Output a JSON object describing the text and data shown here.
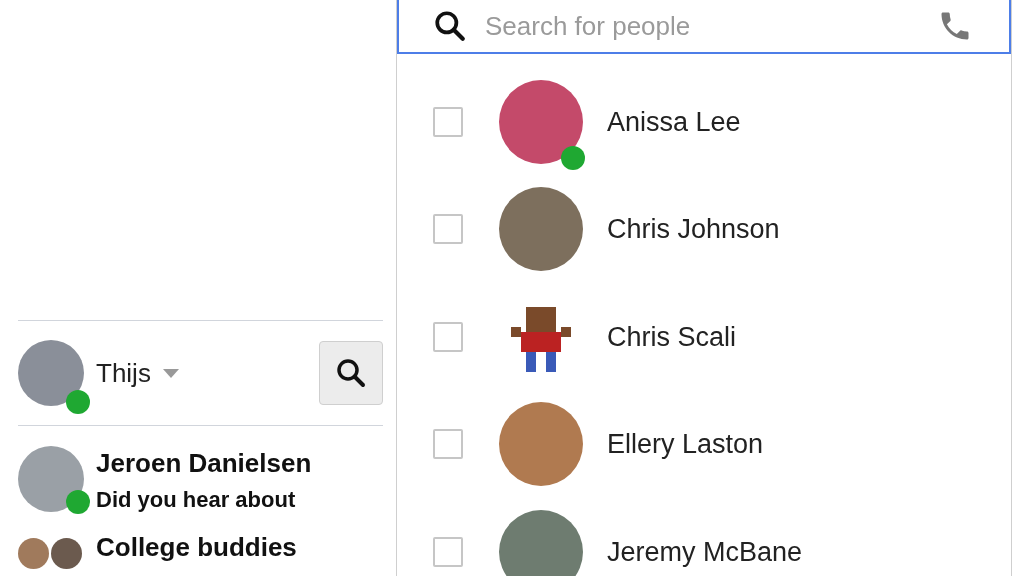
{
  "sidebar": {
    "user": {
      "name": "Thijs",
      "online": true
    },
    "conversations": [
      {
        "kind": "person",
        "name": "Jeroen Danielsen",
        "snippet": "Did you hear about",
        "online": true
      },
      {
        "kind": "group",
        "name": "College buddies"
      }
    ]
  },
  "people_search": {
    "placeholder": "Search for people",
    "contacts": [
      {
        "name": "Anissa Lee",
        "checked": false,
        "online": true
      },
      {
        "name": "Chris Johnson",
        "checked": false,
        "online": false
      },
      {
        "name": "Chris Scali",
        "checked": false,
        "online": false
      },
      {
        "name": "Ellery Laston",
        "checked": false,
        "online": false
      },
      {
        "name": "Jeremy McBane",
        "checked": false,
        "online": false
      }
    ]
  }
}
